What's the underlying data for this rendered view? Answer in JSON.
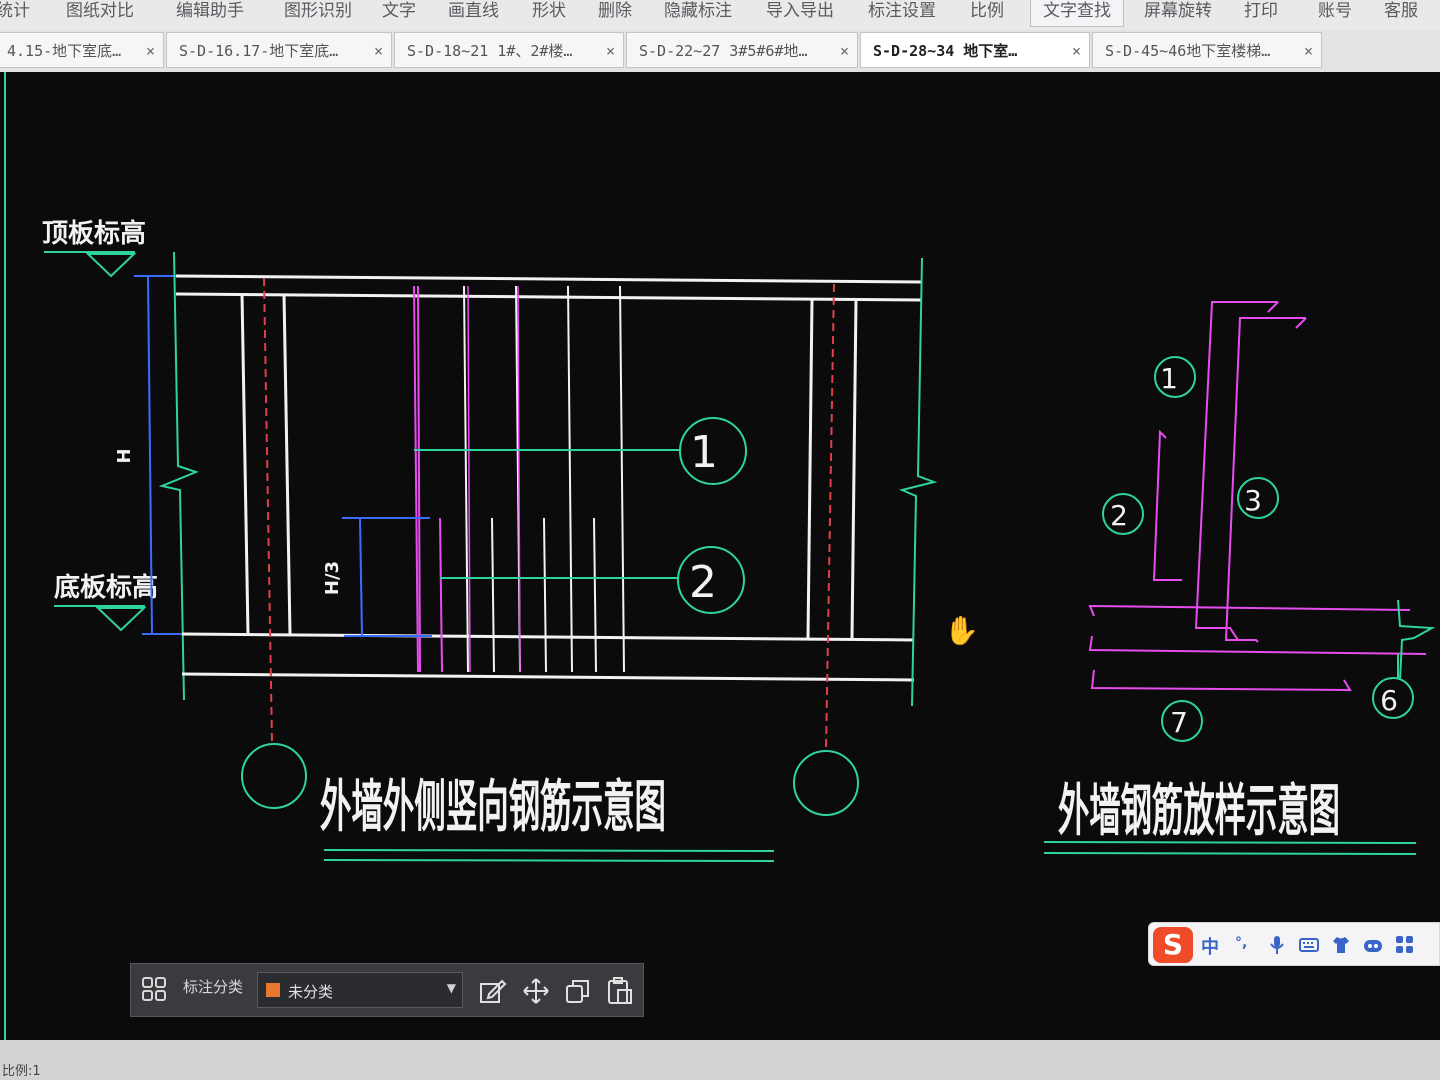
{
  "menu": {
    "items": [
      "统计",
      "图纸对比",
      "编辑助手",
      "图形识别",
      "文字",
      "画直线",
      "形状",
      "删除",
      "隐藏标注",
      "导入导出",
      "标注设置",
      "比例",
      "文字查找",
      "屏幕旋转",
      "打印",
      "账号",
      "客服"
    ]
  },
  "tabs": [
    {
      "label": "4.15-地下室底…",
      "close": "×"
    },
    {
      "label": "S-D-16.17-地下室底…",
      "close": "×"
    },
    {
      "label": "S-D-18~21 1#、2#楼…",
      "close": "×"
    },
    {
      "label": "S-D-22~27 3#5#6#地…",
      "close": "×"
    },
    {
      "label": "S-D-28~34  地下室…",
      "close": "×"
    },
    {
      "label": "S-D-45~46地下室楼梯…",
      "close": "×"
    }
  ],
  "drawing": {
    "left_title": "外墙外侧竖向钢筋示意图",
    "right_title": "外墙钢筋放样示意图",
    "top_elevation": "顶板标高",
    "bottom_elevation": "底板标高",
    "dim_h": "H",
    "dim_h3": "H/3",
    "callouts_left": [
      "1",
      "2"
    ],
    "callouts_right": [
      "1",
      "2",
      "3",
      "6",
      "7"
    ]
  },
  "annot_toolbar": {
    "label": "标注分类",
    "selected": "未分类",
    "swatch_color": "#e8782f",
    "tools": [
      "edit-icon",
      "move-icon",
      "copy-icon",
      "paste-icon"
    ]
  },
  "ime": {
    "logo": "S",
    "mode": "中",
    "punct": "°,",
    "icons": [
      "microphone-icon",
      "keyboard-icon",
      "shirt-icon",
      "emoji-icon",
      "apps-icon"
    ]
  },
  "status": {
    "scale": "比例:1"
  },
  "colors": {
    "canvas": "#0b0b0c",
    "green": "#2fd3a0",
    "magenta": "#e84cf0",
    "blue": "#3a6cff",
    "red_dashed": "#e0404a",
    "white": "#f2f2f2"
  }
}
